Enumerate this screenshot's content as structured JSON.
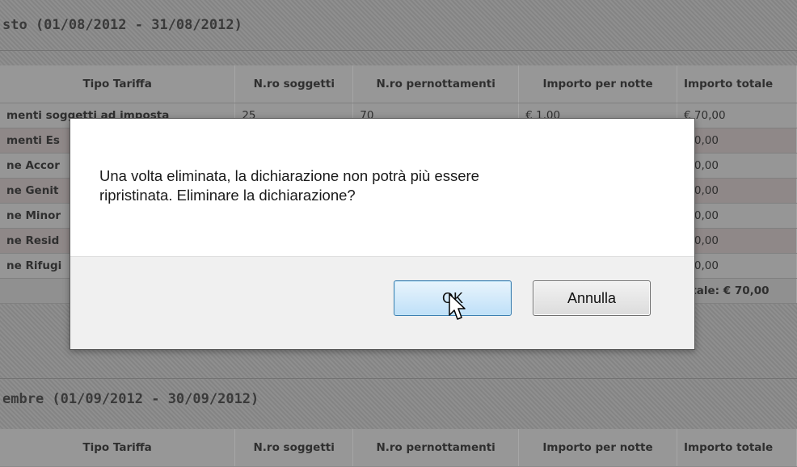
{
  "background": {
    "section1": {
      "title": "sto (01/08/2012 - 31/08/2012)"
    },
    "section2": {
      "title": "embre (01/09/2012 - 30/09/2012)"
    },
    "table": {
      "headers": [
        "Tipo Tariffa",
        "N.ro soggetti",
        "N.ro pernottamenti",
        "Importo per notte",
        "Importo totale"
      ],
      "rows": [
        [
          "menti soggetti ad imposta",
          "25",
          "70",
          "€ 1,00",
          "€ 70,00"
        ],
        [
          "menti Es",
          "",
          "",
          "",
          "€ 0,00"
        ],
        [
          "ne Accor",
          "",
          "",
          "",
          "€ 0,00"
        ],
        [
          "ne Genit",
          "",
          "",
          "",
          "€ 0,00"
        ],
        [
          "ne Minor",
          "",
          "",
          "",
          "€ 0,00"
        ],
        [
          "ne Resid",
          "",
          "",
          "",
          "€ 0,00"
        ],
        [
          "ne Rifugi",
          "",
          "",
          "",
          "€ 0,00"
        ]
      ],
      "total": "otale: € 70,00"
    }
  },
  "dialog": {
    "message_line1": "Una volta eliminata, la dichiarazione non potrà più essere",
    "message_line2": "ripristinata. Eliminare la dichiarazione?",
    "ok_label": "OK",
    "cancel_label": "Annulla"
  },
  "icons": {
    "cursor": "mouse-pointer-icon"
  },
  "colors": {
    "ok_border": "#3c7fb1",
    "ok_fill": "#bfe0f8",
    "backdrop": "#959595"
  }
}
